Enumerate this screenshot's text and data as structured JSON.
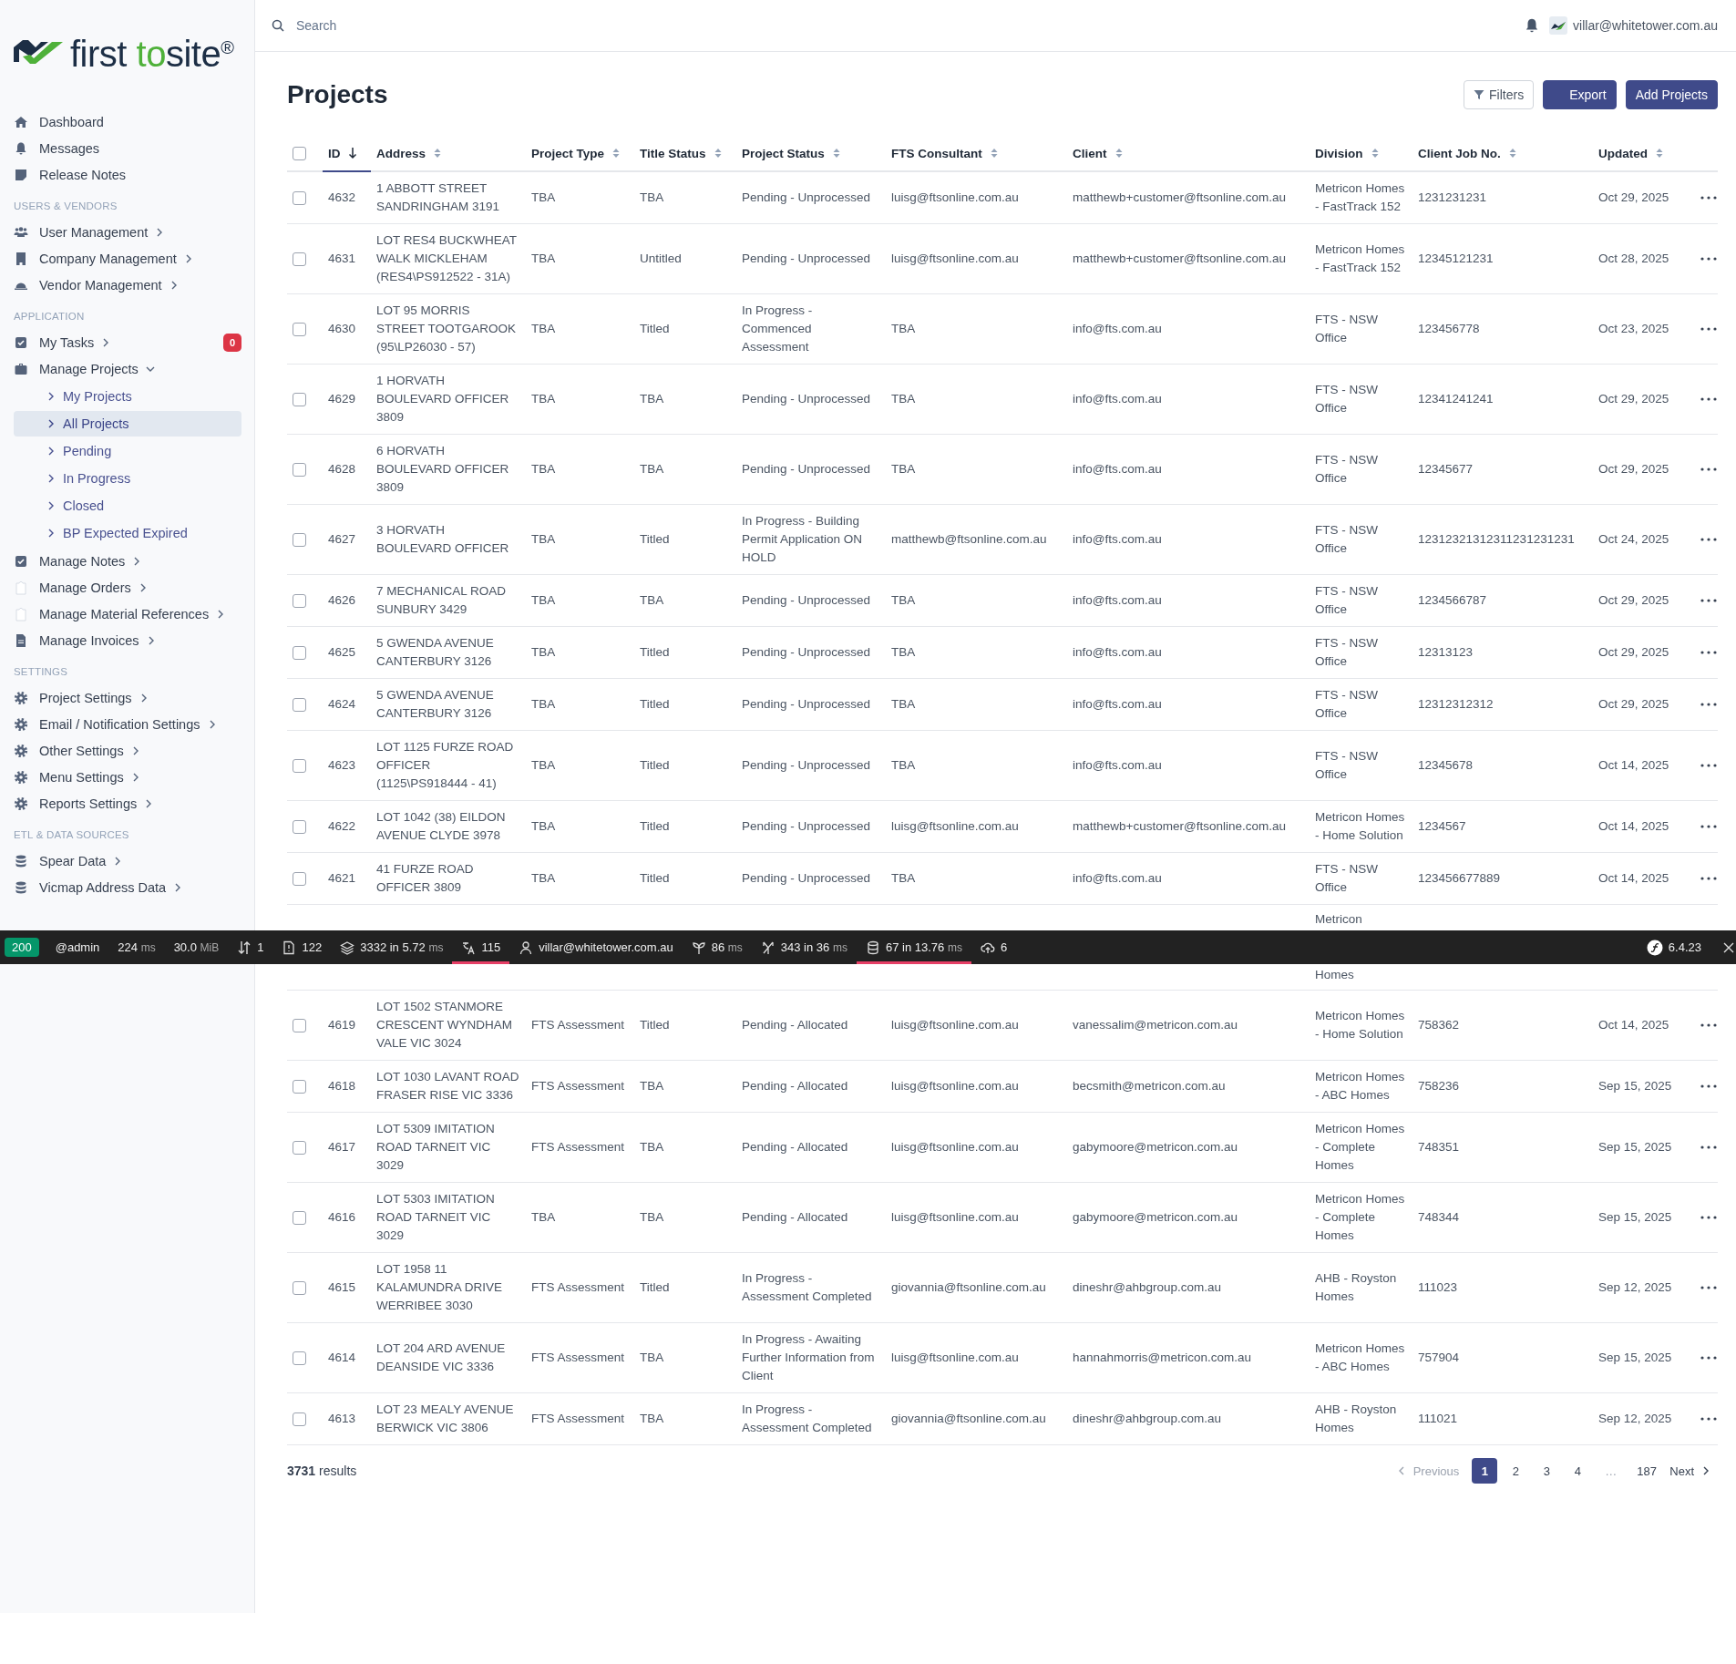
{
  "logo": {
    "first": "first",
    "highlight": "to",
    "last": "site",
    "mark": "®"
  },
  "sidebar": {
    "sections": [
      {
        "items": [
          {
            "label": "Dashboard"
          },
          {
            "label": "Messages"
          },
          {
            "label": "Release Notes"
          }
        ]
      },
      {
        "heading": "USERS & VENDORS",
        "items": [
          {
            "label": "User Management",
            "expanded": false
          },
          {
            "label": "Company Management",
            "expanded": false
          },
          {
            "label": "Vendor Management",
            "expanded": false
          }
        ]
      },
      {
        "heading": "APPLICATION",
        "items": [
          {
            "label": "My Tasks",
            "expanded": false,
            "badge": "0"
          },
          {
            "label": "Manage Projects",
            "expanded": true,
            "children": [
              {
                "label": "My Projects",
                "selected": false
              },
              {
                "label": "All Projects",
                "selected": true
              },
              {
                "label": "Pending",
                "selected": false
              },
              {
                "label": "In Progress",
                "selected": false
              },
              {
                "label": "Closed",
                "selected": false
              },
              {
                "label": "BP Expected Expired",
                "selected": false
              }
            ]
          },
          {
            "label": "Manage Notes",
            "expanded": false
          },
          {
            "label": "Manage Orders",
            "expanded": false
          },
          {
            "label": "Manage Material References",
            "expanded": false
          },
          {
            "label": "Manage Invoices",
            "expanded": false
          }
        ]
      },
      {
        "heading": "SETTINGS",
        "items": [
          {
            "label": "Project Settings",
            "expanded": false
          },
          {
            "label": "Email / Notification Settings",
            "expanded": false
          },
          {
            "label": "Other Settings",
            "expanded": false
          },
          {
            "label": "Menu Settings",
            "expanded": false
          },
          {
            "label": "Reports Settings",
            "expanded": false
          }
        ]
      },
      {
        "heading": "ETL & DATA SOURCES",
        "items": [
          {
            "label": "Spear Data",
            "expanded": false
          },
          {
            "label": "Vicmap Address Data",
            "expanded": false
          }
        ]
      }
    ]
  },
  "topbar": {
    "search": {
      "placeholder": "Search"
    },
    "user": "villar@whitetower.com.au"
  },
  "page_title": "Projects",
  "actions": [
    {
      "label": "Filters",
      "kind": "outline"
    },
    {
      "label": "Export",
      "kind": "primary"
    },
    {
      "label": "Add Projects",
      "kind": "primary"
    }
  ],
  "table": {
    "select_all": {
      "checked": false
    },
    "columns": [
      {
        "label": "ID",
        "sorted": true
      },
      {
        "label": "Address",
        "sorted": false
      },
      {
        "label": "Project Type",
        "sorted": false
      },
      {
        "label": "Title Status",
        "sorted": false
      },
      {
        "label": "Project Status",
        "sorted": false
      },
      {
        "label": "FTS Consultant",
        "sorted": false
      },
      {
        "label": "Client",
        "sorted": false
      },
      {
        "label": "Division",
        "sorted": false
      },
      {
        "label": "Client Job No.",
        "sorted": false
      },
      {
        "label": "Updated",
        "sorted": false
      }
    ],
    "rows_above": [
      {
        "checked": false,
        "cells": [
          "4632",
          "1 ABBOTT STREET SANDRINGHAM 3191",
          "TBA",
          "TBA",
          "Pending - Unprocessed",
          "luisg@ftsonline.com.au",
          "matthewb+customer@ftsonline.com.au",
          "Metricon Homes - FastTrack 152",
          "1231231231",
          "Oct 29, 2025"
        ]
      },
      {
        "checked": false,
        "cells": [
          "4631",
          "LOT RES4 BUCKWHEAT WALK MICKLEHAM (RES4\\PS912522 - 31A)",
          "TBA",
          "Untitled",
          "Pending - Unprocessed",
          "luisg@ftsonline.com.au",
          "matthewb+customer@ftsonline.com.au",
          "Metricon Homes - FastTrack 152",
          "12345121231",
          "Oct 28, 2025"
        ]
      },
      {
        "checked": false,
        "cells": [
          "4630",
          "LOT 95 MORRIS STREET TOOTGAROOK (95\\LP26030 - 57)",
          "TBA",
          "Titled",
          "In Progress - Commenced Assessment",
          "TBA",
          "info@fts.com.au",
          "FTS - NSW Office",
          "123456778",
          "Oct 23, 2025"
        ]
      },
      {
        "checked": false,
        "cells": [
          "4629",
          "1 HORVATH BOULEVARD OFFICER 3809",
          "TBA",
          "TBA",
          "Pending - Unprocessed",
          "TBA",
          "info@fts.com.au",
          "FTS - NSW Office",
          "12341241241",
          "Oct 29, 2025"
        ]
      },
      {
        "checked": false,
        "cells": [
          "4628",
          "6 HORVATH BOULEVARD OFFICER 3809",
          "TBA",
          "TBA",
          "Pending - Unprocessed",
          "TBA",
          "info@fts.com.au",
          "FTS - NSW Office",
          "12345677",
          "Oct 29, 2025"
        ]
      },
      {
        "checked": false,
        "cells": [
          "4627",
          "3 HORVATH BOULEVARD OFFICER",
          "TBA",
          "Titled",
          "In Progress - Building Permit Application ON HOLD",
          "matthewb@ftsonline.com.au",
          "info@fts.com.au",
          "FTS - NSW Office",
          "12312321312311231231231",
          "Oct 24, 2025"
        ]
      },
      {
        "checked": false,
        "cells": [
          "4626",
          "7 MECHANICAL ROAD SUNBURY 3429",
          "TBA",
          "TBA",
          "Pending - Unprocessed",
          "TBA",
          "info@fts.com.au",
          "FTS - NSW Office",
          "1234566787",
          "Oct 29, 2025"
        ]
      },
      {
        "checked": false,
        "cells": [
          "4625",
          "5 GWENDA AVENUE CANTERBURY 3126",
          "TBA",
          "Titled",
          "Pending - Unprocessed",
          "TBA",
          "info@fts.com.au",
          "FTS - NSW Office",
          "12313123",
          "Oct 29, 2025"
        ]
      },
      {
        "checked": false,
        "cells": [
          "4624",
          "5 GWENDA AVENUE CANTERBURY 3126",
          "TBA",
          "Titled",
          "Pending - Unprocessed",
          "TBA",
          "info@fts.com.au",
          "FTS - NSW Office",
          "12312312312",
          "Oct 29, 2025"
        ]
      },
      {
        "checked": false,
        "cells": [
          "4623",
          "LOT 1125 FURZE ROAD OFFICER (1125\\PS918444 - 41)",
          "TBA",
          "Titled",
          "Pending - Unprocessed",
          "TBA",
          "info@fts.com.au",
          "FTS - NSW Office",
          "12345678",
          "Oct 14, 2025"
        ]
      },
      {
        "checked": false,
        "cells": [
          "4622",
          "LOT 1042 (38) EILDON AVENUE CLYDE 3978",
          "TBA",
          "Titled",
          "Pending - Unprocessed",
          "luisg@ftsonline.com.au",
          "matthewb+customer@ftsonline.com.au",
          "Metricon Homes - Home Solution",
          "1234567",
          "Oct 14, 2025"
        ]
      },
      {
        "checked": false,
        "cells": [
          "4621",
          "41 FURZE ROAD OFFICER 3809",
          "TBA",
          "Titled",
          "Pending - Unprocessed",
          "TBA",
          "info@fts.com.au",
          "FTS - NSW Office",
          "123456677889",
          "Oct 14, 2025"
        ]
      }
    ],
    "cut_row": {
      "division_above": "Metricon",
      "division_below": "Homes"
    },
    "rows_below": [
      {
        "checked": false,
        "cells": [
          "4619",
          "LOT 1502 STANMORE CRESCENT WYNDHAM VALE VIC 3024",
          "FTS Assessment",
          "Titled",
          "Pending - Allocated",
          "luisg@ftsonline.com.au",
          "vanessalim@metricon.com.au",
          "Metricon Homes - Home Solution",
          "758362",
          "Oct 14, 2025"
        ]
      },
      {
        "checked": false,
        "cells": [
          "4618",
          "LOT 1030 LAVANT ROAD FRASER RISE VIC 3336",
          "FTS Assessment",
          "TBA",
          "Pending - Allocated",
          "luisg@ftsonline.com.au",
          "becsmith@metricon.com.au",
          "Metricon Homes - ABC Homes",
          "758236",
          "Sep 15, 2025"
        ]
      },
      {
        "checked": false,
        "cells": [
          "4617",
          "LOT 5309 IMITATION ROAD TARNEIT VIC 3029",
          "FTS Assessment",
          "TBA",
          "Pending - Allocated",
          "luisg@ftsonline.com.au",
          "gabymoore@metricon.com.au",
          "Metricon Homes - Complete Homes",
          "748351",
          "Sep 15, 2025"
        ]
      },
      {
        "checked": false,
        "cells": [
          "4616",
          "LOT 5303 IMITATION ROAD TARNEIT VIC 3029",
          "TBA",
          "TBA",
          "Pending - Allocated",
          "luisg@ftsonline.com.au",
          "gabymoore@metricon.com.au",
          "Metricon Homes - Complete Homes",
          "748344",
          "Sep 15, 2025"
        ]
      },
      {
        "checked": false,
        "cells": [
          "4615",
          "LOT 1958 11 KALAMUNDRA DRIVE WERRIBEE 3030",
          "FTS Assessment",
          "Titled",
          "In Progress - Assessment Completed",
          "giovannia@ftsonline.com.au",
          "dineshr@ahbgroup.com.au",
          "AHB - Royston Homes",
          "111023",
          "Sep 12, 2025"
        ]
      },
      {
        "checked": false,
        "cells": [
          "4614",
          "LOT 204 ARD AVENUE DEANSIDE VIC 3336",
          "FTS Assessment",
          "TBA",
          "In Progress - Awaiting Further Information from Client",
          "luisg@ftsonline.com.au",
          "hannahmorris@metricon.com.au",
          "Metricon Homes - ABC Homes",
          "757904",
          "Sep 15, 2025"
        ]
      },
      {
        "checked": false,
        "cells": [
          "4613",
          "LOT 23 MEALY AVENUE BERWICK VIC 3806",
          "FTS Assessment",
          "TBA",
          "In Progress - Assessment Completed",
          "giovannia@ftsonline.com.au",
          "dineshr@ahbgroup.com.au",
          "AHB - Royston Homes",
          "111021",
          "Sep 12, 2025"
        ]
      }
    ]
  },
  "results": {
    "count": "3731",
    "label": "results"
  },
  "pagination": {
    "previous": {
      "label": "Previous",
      "disabled": true
    },
    "next": {
      "label": "Next",
      "disabled": false
    },
    "pages": [
      {
        "label": "1",
        "kind": "page",
        "selected": true
      },
      {
        "label": "2",
        "kind": "page",
        "selected": false
      },
      {
        "label": "3",
        "kind": "page",
        "selected": false
      },
      {
        "label": "4",
        "kind": "page",
        "selected": false
      },
      {
        "label": "…",
        "kind": "gap"
      },
      {
        "label": "187",
        "kind": "page",
        "selected": false
      }
    ]
  },
  "debug_bar": {
    "status": "200",
    "items": [
      {
        "value": "@admin",
        "highlighted": false
      },
      {
        "value": "224",
        "unit": "ms",
        "highlighted": false
      },
      {
        "value": "30.0",
        "unit": "MiB",
        "highlighted": false
      },
      {
        "value": "1",
        "highlighted": false
      },
      {
        "value": "122",
        "highlighted": false
      },
      {
        "value": "3332 in 5.72",
        "unit": "ms",
        "highlighted": false
      },
      {
        "value": "115",
        "highlighted": true
      },
      {
        "value": "villar@whitetower.com.au",
        "highlighted": false
      },
      {
        "value": "86",
        "unit": "ms",
        "highlighted": false
      },
      {
        "value": "343 in 36",
        "unit": "ms",
        "highlighted": false
      },
      {
        "value": "67 in 13.76",
        "unit": "ms",
        "highlighted": true
      },
      {
        "value": "6",
        "highlighted": false
      }
    ],
    "version": "6.4.23"
  }
}
